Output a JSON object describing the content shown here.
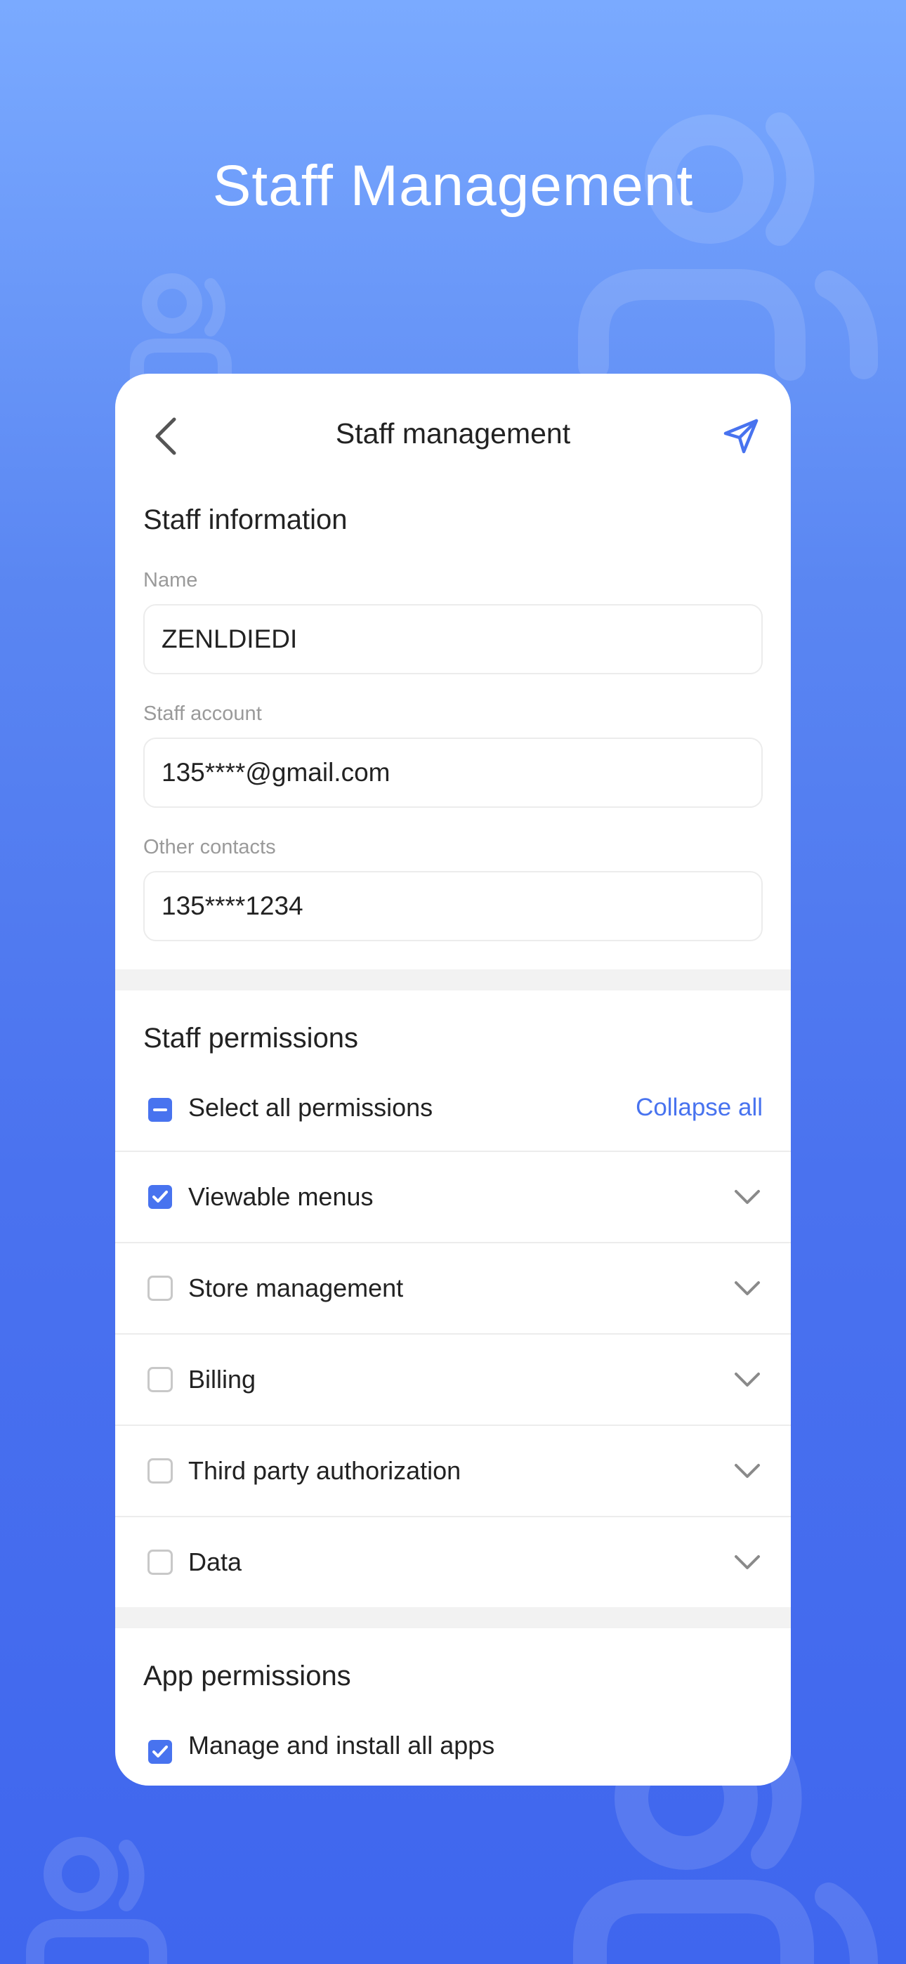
{
  "hero": {
    "title": "Staff Management"
  },
  "nav": {
    "title": "Staff management"
  },
  "staff_info": {
    "title": "Staff information",
    "fields": [
      {
        "label": "Name",
        "value": "ZENLDIEDI"
      },
      {
        "label": "Staff account",
        "value": "135****@gmail.com"
      },
      {
        "label": "Other contacts",
        "value": "135****1234"
      }
    ]
  },
  "staff_permissions": {
    "title": "Staff permissions",
    "select_all_label": "Select all permissions",
    "collapse_label": "Collapse all",
    "items": [
      {
        "label": "Viewable menus",
        "checked": true
      },
      {
        "label": "Store management",
        "checked": false
      },
      {
        "label": "Billing",
        "checked": false
      },
      {
        "label": "Third party authorization",
        "checked": false
      },
      {
        "label": "Data",
        "checked": false
      }
    ]
  },
  "app_permissions": {
    "title": "App permissions",
    "items": [
      {
        "label": "Manage and install all apps",
        "checked": true
      }
    ]
  },
  "colors": {
    "accent": "#4873ef",
    "border": "#ececec",
    "muted": "#9a9a9a"
  },
  "icons": {
    "back": "chevron-left-icon",
    "send": "paper-plane-icon",
    "expand": "chevron-down-icon"
  }
}
